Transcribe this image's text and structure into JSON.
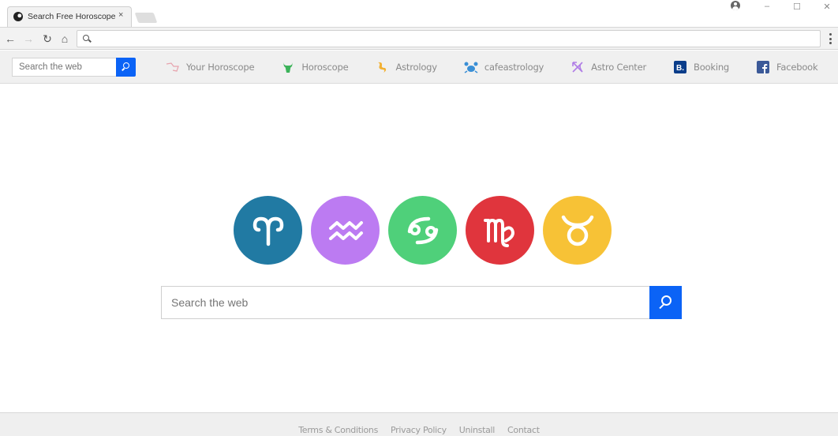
{
  "browser": {
    "tab_title": "Search Free Horoscope",
    "tab_close": "×",
    "window_controls": {
      "minimize": "–",
      "maximize": "☐",
      "close": "✕"
    },
    "nav": {
      "back": "←",
      "forward": "→",
      "reload": "↻",
      "home": "⌂"
    },
    "address_value": ""
  },
  "header": {
    "search_placeholder": "Search the web",
    "links": [
      {
        "label": "Your Horoscope",
        "icon": "constellation-icon",
        "color": "#e7a3ad"
      },
      {
        "label": "Horoscope",
        "icon": "bull-icon",
        "color": "#3cb35a"
      },
      {
        "label": "Astrology",
        "icon": "sun-moon-icon",
        "color": "#f2b134"
      },
      {
        "label": "cafeastrology",
        "icon": "crab-icon",
        "color": "#3a8fd6"
      },
      {
        "label": "Astro Center",
        "icon": "sagittarius-icon",
        "color": "#b07ee6"
      },
      {
        "label": "Booking",
        "icon": "booking-icon",
        "color": "#0a3d8a"
      },
      {
        "label": "Facebook",
        "icon": "facebook-icon",
        "color": "#3b5998"
      }
    ]
  },
  "zodiac": [
    {
      "name": "Aries",
      "glyph": "aries-icon",
      "color": "#217aa3"
    },
    {
      "name": "Aquarius",
      "glyph": "aquarius-icon",
      "color": "#bc7bf2"
    },
    {
      "name": "Cancer",
      "glyph": "cancer-icon",
      "color": "#4fd07a"
    },
    {
      "name": "Virgo",
      "glyph": "virgo-icon",
      "color": "#e0353d"
    },
    {
      "name": "Taurus",
      "glyph": "taurus-icon",
      "color": "#f7c236"
    }
  ],
  "main_search": {
    "placeholder": "Search the web"
  },
  "footer": {
    "links": [
      "Terms & Conditions",
      "Privacy Policy",
      "Uninstall",
      "Contact"
    ]
  },
  "colors": {
    "accent": "#0b63f6"
  }
}
